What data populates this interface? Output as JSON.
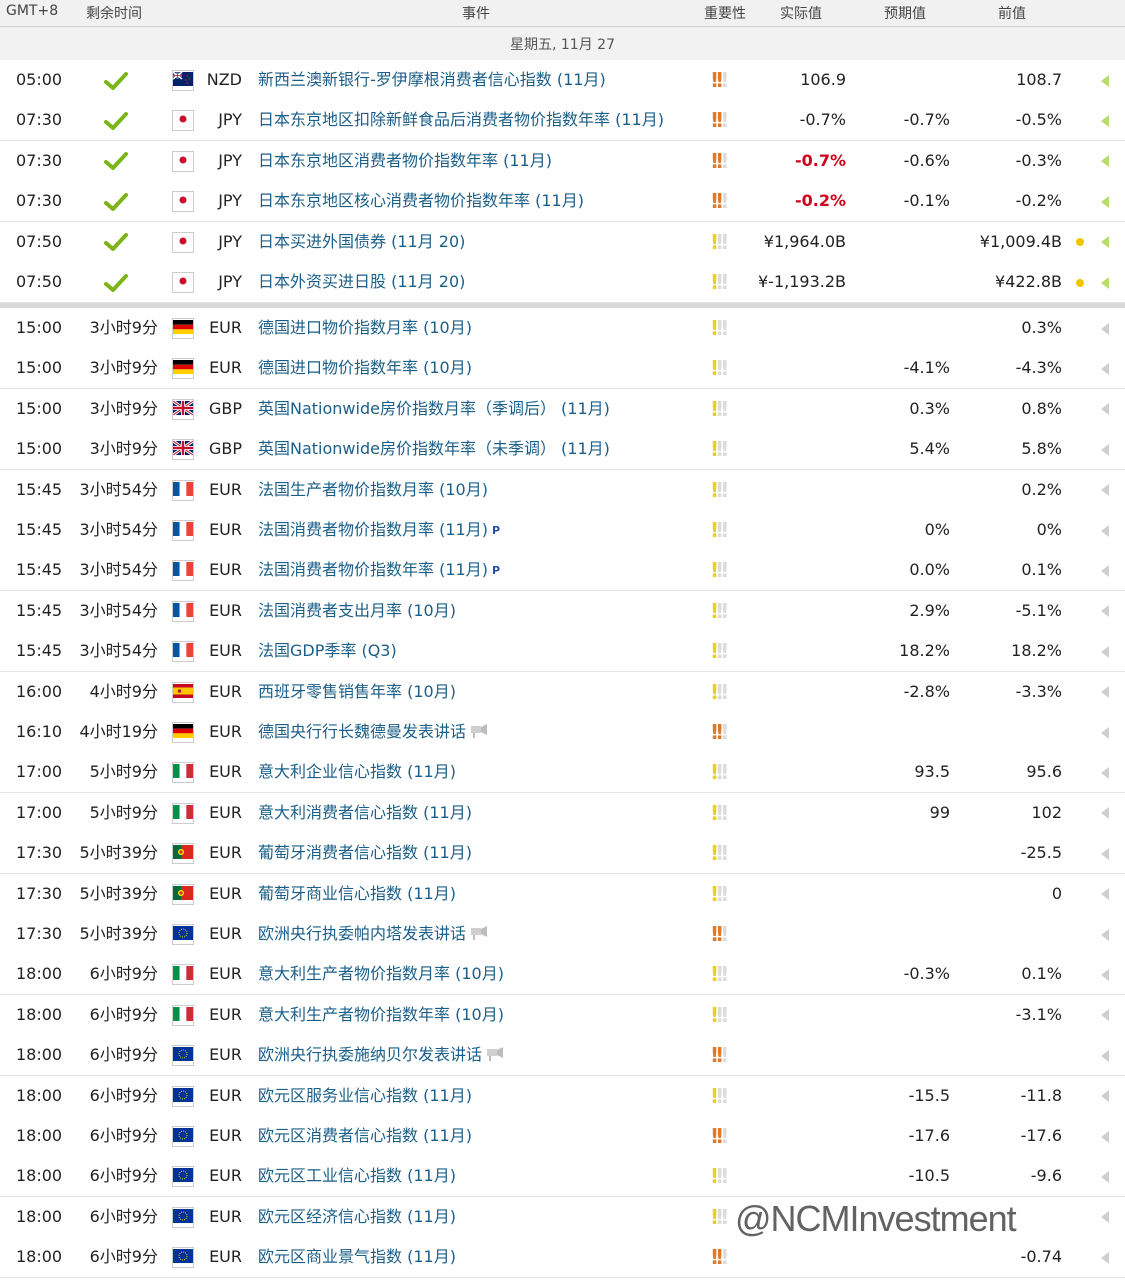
{
  "header": {
    "gmt": "GMT+8",
    "remaining": "剩余时间",
    "event": "事件",
    "importance": "重要性",
    "actual": "实际值",
    "forecast": "预期值",
    "previous": "前值"
  },
  "day_label": "星期五, 11月 27",
  "colors": {
    "accent": "#1a5f8a",
    "check": "#7cb518",
    "high": "#e07a2b",
    "low": "#e8d21c",
    "negative": "#d0021b",
    "dot": "#f2c400"
  },
  "rows": [
    {
      "time": "05:00",
      "remain": "",
      "done": true,
      "flag": "nz",
      "cur": "NZD",
      "event": "新西兰澳新银行-罗伊摩根消费者信心指数 (11月)",
      "icon": "",
      "imp": "high",
      "actual": "106.9",
      "actual_neg": false,
      "forecast": "",
      "prev": "108.7",
      "dot": false
    },
    {
      "time": "07:30",
      "remain": "",
      "done": true,
      "flag": "jp",
      "cur": "JPY",
      "event": "日本东京地区扣除新鲜食品后消费者物价指数年率 (11月)",
      "icon": "",
      "imp": "high",
      "actual": "-0.7%",
      "actual_neg": false,
      "forecast": "-0.7%",
      "prev": "-0.5%",
      "dot": false
    },
    {
      "time": "07:30",
      "remain": "",
      "done": true,
      "flag": "jp",
      "cur": "JPY",
      "event": "日本东京地区消费者物价指数年率 (11月)",
      "icon": "",
      "imp": "high",
      "actual": "-0.7%",
      "actual_neg": true,
      "forecast": "-0.6%",
      "prev": "-0.3%",
      "dot": false
    },
    {
      "time": "07:30",
      "remain": "",
      "done": true,
      "flag": "jp",
      "cur": "JPY",
      "event": "日本东京地区核心消费者物价指数年率 (11月)",
      "icon": "",
      "imp": "high",
      "actual": "-0.2%",
      "actual_neg": true,
      "forecast": "-0.1%",
      "prev": "-0.2%",
      "dot": false
    },
    {
      "time": "07:50",
      "remain": "",
      "done": true,
      "flag": "jp",
      "cur": "JPY",
      "event": "日本买进外国债券 (11月 20)",
      "icon": "",
      "imp": "low",
      "actual": "¥1,964.0B",
      "actual_neg": false,
      "forecast": "",
      "prev": "¥1,009.4B",
      "dot": true
    },
    {
      "time": "07:50",
      "remain": "",
      "done": true,
      "flag": "jp",
      "cur": "JPY",
      "event": "日本外资买进日股 (11月 20)",
      "icon": "",
      "imp": "low",
      "actual": "¥-1,193.2B",
      "actual_neg": false,
      "forecast": "",
      "prev": "¥422.8B",
      "dot": true
    },
    {
      "time": "15:00",
      "remain": "3小时9分",
      "done": false,
      "flag": "de",
      "cur": "EUR",
      "event": "德国进口物价指数月率 (10月)",
      "icon": "",
      "imp": "low",
      "actual": "",
      "actual_neg": false,
      "forecast": "",
      "prev": "0.3%",
      "dot": false
    },
    {
      "time": "15:00",
      "remain": "3小时9分",
      "done": false,
      "flag": "de",
      "cur": "EUR",
      "event": "德国进口物价指数年率 (10月)",
      "icon": "",
      "imp": "low",
      "actual": "",
      "actual_neg": false,
      "forecast": "-4.1%",
      "prev": "-4.3%",
      "dot": false
    },
    {
      "time": "15:00",
      "remain": "3小时9分",
      "done": false,
      "flag": "gb",
      "cur": "GBP",
      "event": "英国Nationwide房价指数月率（季调后） (11月)",
      "icon": "",
      "imp": "low",
      "actual": "",
      "actual_neg": false,
      "forecast": "0.3%",
      "prev": "0.8%",
      "dot": false
    },
    {
      "time": "15:00",
      "remain": "3小时9分",
      "done": false,
      "flag": "gb",
      "cur": "GBP",
      "event": "英国Nationwide房价指数年率（未季调） (11月)",
      "icon": "",
      "imp": "low",
      "actual": "",
      "actual_neg": false,
      "forecast": "5.4%",
      "prev": "5.8%",
      "dot": false
    },
    {
      "time": "15:45",
      "remain": "3小时54分",
      "done": false,
      "flag": "fr",
      "cur": "EUR",
      "event": "法国生产者物价指数月率 (10月)",
      "icon": "",
      "imp": "low",
      "actual": "",
      "actual_neg": false,
      "forecast": "",
      "prev": "0.2%",
      "dot": false
    },
    {
      "time": "15:45",
      "remain": "3小时54分",
      "done": false,
      "flag": "fr",
      "cur": "EUR",
      "event": "法国消费者物价指数月率 (11月)",
      "icon": "P",
      "imp": "low",
      "actual": "",
      "actual_neg": false,
      "forecast": "0%",
      "prev": "0%",
      "dot": false
    },
    {
      "time": "15:45",
      "remain": "3小时54分",
      "done": false,
      "flag": "fr",
      "cur": "EUR",
      "event": "法国消费者物价指数年率 (11月)",
      "icon": "P",
      "imp": "low",
      "actual": "",
      "actual_neg": false,
      "forecast": "0.0%",
      "prev": "0.1%",
      "dot": false
    },
    {
      "time": "15:45",
      "remain": "3小时54分",
      "done": false,
      "flag": "fr",
      "cur": "EUR",
      "event": "法国消费者支出月率 (10月)",
      "icon": "",
      "imp": "low",
      "actual": "",
      "actual_neg": false,
      "forecast": "2.9%",
      "prev": "-5.1%",
      "dot": false
    },
    {
      "time": "15:45",
      "remain": "3小时54分",
      "done": false,
      "flag": "fr",
      "cur": "EUR",
      "event": "法国GDP季率 (Q3)",
      "icon": "",
      "imp": "low",
      "actual": "",
      "actual_neg": false,
      "forecast": "18.2%",
      "prev": "18.2%",
      "dot": false
    },
    {
      "time": "16:00",
      "remain": "4小时9分",
      "done": false,
      "flag": "es",
      "cur": "EUR",
      "event": "西班牙零售销售年率 (10月)",
      "icon": "",
      "imp": "low",
      "actual": "",
      "actual_neg": false,
      "forecast": "-2.8%",
      "prev": "-3.3%",
      "dot": false
    },
    {
      "time": "16:10",
      "remain": "4小时19分",
      "done": false,
      "flag": "de",
      "cur": "EUR",
      "event": "德国央行行长魏德曼发表讲话",
      "icon": "speech",
      "imp": "high",
      "actual": "",
      "actual_neg": false,
      "forecast": "",
      "prev": "",
      "dot": false
    },
    {
      "time": "17:00",
      "remain": "5小时9分",
      "done": false,
      "flag": "it",
      "cur": "EUR",
      "event": "意大利企业信心指数 (11月)",
      "icon": "",
      "imp": "low",
      "actual": "",
      "actual_neg": false,
      "forecast": "93.5",
      "prev": "95.6",
      "dot": false
    },
    {
      "time": "17:00",
      "remain": "5小时9分",
      "done": false,
      "flag": "it",
      "cur": "EUR",
      "event": "意大利消费者信心指数 (11月)",
      "icon": "",
      "imp": "low",
      "actual": "",
      "actual_neg": false,
      "forecast": "99",
      "prev": "102",
      "dot": false
    },
    {
      "time": "17:30",
      "remain": "5小时39分",
      "done": false,
      "flag": "pt",
      "cur": "EUR",
      "event": "葡萄牙消费者信心指数 (11月)",
      "icon": "",
      "imp": "low",
      "actual": "",
      "actual_neg": false,
      "forecast": "",
      "prev": "-25.5",
      "dot": false
    },
    {
      "time": "17:30",
      "remain": "5小时39分",
      "done": false,
      "flag": "pt",
      "cur": "EUR",
      "event": "葡萄牙商业信心指数 (11月)",
      "icon": "",
      "imp": "low",
      "actual": "",
      "actual_neg": false,
      "forecast": "",
      "prev": "0",
      "dot": false
    },
    {
      "time": "17:30",
      "remain": "5小时39分",
      "done": false,
      "flag": "eu",
      "cur": "EUR",
      "event": "欧洲央行执委帕内塔发表讲话",
      "icon": "speech",
      "imp": "high",
      "actual": "",
      "actual_neg": false,
      "forecast": "",
      "prev": "",
      "dot": false
    },
    {
      "time": "18:00",
      "remain": "6小时9分",
      "done": false,
      "flag": "it",
      "cur": "EUR",
      "event": "意大利生产者物价指数月率 (10月)",
      "icon": "",
      "imp": "low",
      "actual": "",
      "actual_neg": false,
      "forecast": "-0.3%",
      "prev": "0.1%",
      "dot": false
    },
    {
      "time": "18:00",
      "remain": "6小时9分",
      "done": false,
      "flag": "it",
      "cur": "EUR",
      "event": "意大利生产者物价指数年率 (10月)",
      "icon": "",
      "imp": "low",
      "actual": "",
      "actual_neg": false,
      "forecast": "",
      "prev": "-3.1%",
      "dot": false
    },
    {
      "time": "18:00",
      "remain": "6小时9分",
      "done": false,
      "flag": "eu",
      "cur": "EUR",
      "event": "欧洲央行执委施纳贝尔发表讲话",
      "icon": "speech",
      "imp": "high",
      "actual": "",
      "actual_neg": false,
      "forecast": "",
      "prev": "",
      "dot": false
    },
    {
      "time": "18:00",
      "remain": "6小时9分",
      "done": false,
      "flag": "eu",
      "cur": "EUR",
      "event": "欧元区服务业信心指数 (11月)",
      "icon": "",
      "imp": "low",
      "actual": "",
      "actual_neg": false,
      "forecast": "-15.5",
      "prev": "-11.8",
      "dot": false
    },
    {
      "time": "18:00",
      "remain": "6小时9分",
      "done": false,
      "flag": "eu",
      "cur": "EUR",
      "event": "欧元区消费者信心指数 (11月)",
      "icon": "",
      "imp": "high",
      "actual": "",
      "actual_neg": false,
      "forecast": "-17.6",
      "prev": "-17.6",
      "dot": false
    },
    {
      "time": "18:00",
      "remain": "6小时9分",
      "done": false,
      "flag": "eu",
      "cur": "EUR",
      "event": "欧元区工业信心指数 (11月)",
      "icon": "",
      "imp": "low",
      "actual": "",
      "actual_neg": false,
      "forecast": "-10.5",
      "prev": "-9.6",
      "dot": false
    },
    {
      "time": "18:00",
      "remain": "6小时9分",
      "done": false,
      "flag": "eu",
      "cur": "EUR",
      "event": "欧元区经济信心指数 (11月)",
      "icon": "",
      "imp": "low",
      "actual": "",
      "actual_neg": false,
      "forecast": "",
      "prev": "",
      "dot": false
    },
    {
      "time": "18:00",
      "remain": "6小时9分",
      "done": false,
      "flag": "eu",
      "cur": "EUR",
      "event": "欧元区商业景气指数 (11月)",
      "icon": "",
      "imp": "high",
      "actual": "",
      "actual_neg": false,
      "forecast": "",
      "prev": "-0.74",
      "dot": false
    }
  ],
  "watermark": "@NCMInvestment"
}
